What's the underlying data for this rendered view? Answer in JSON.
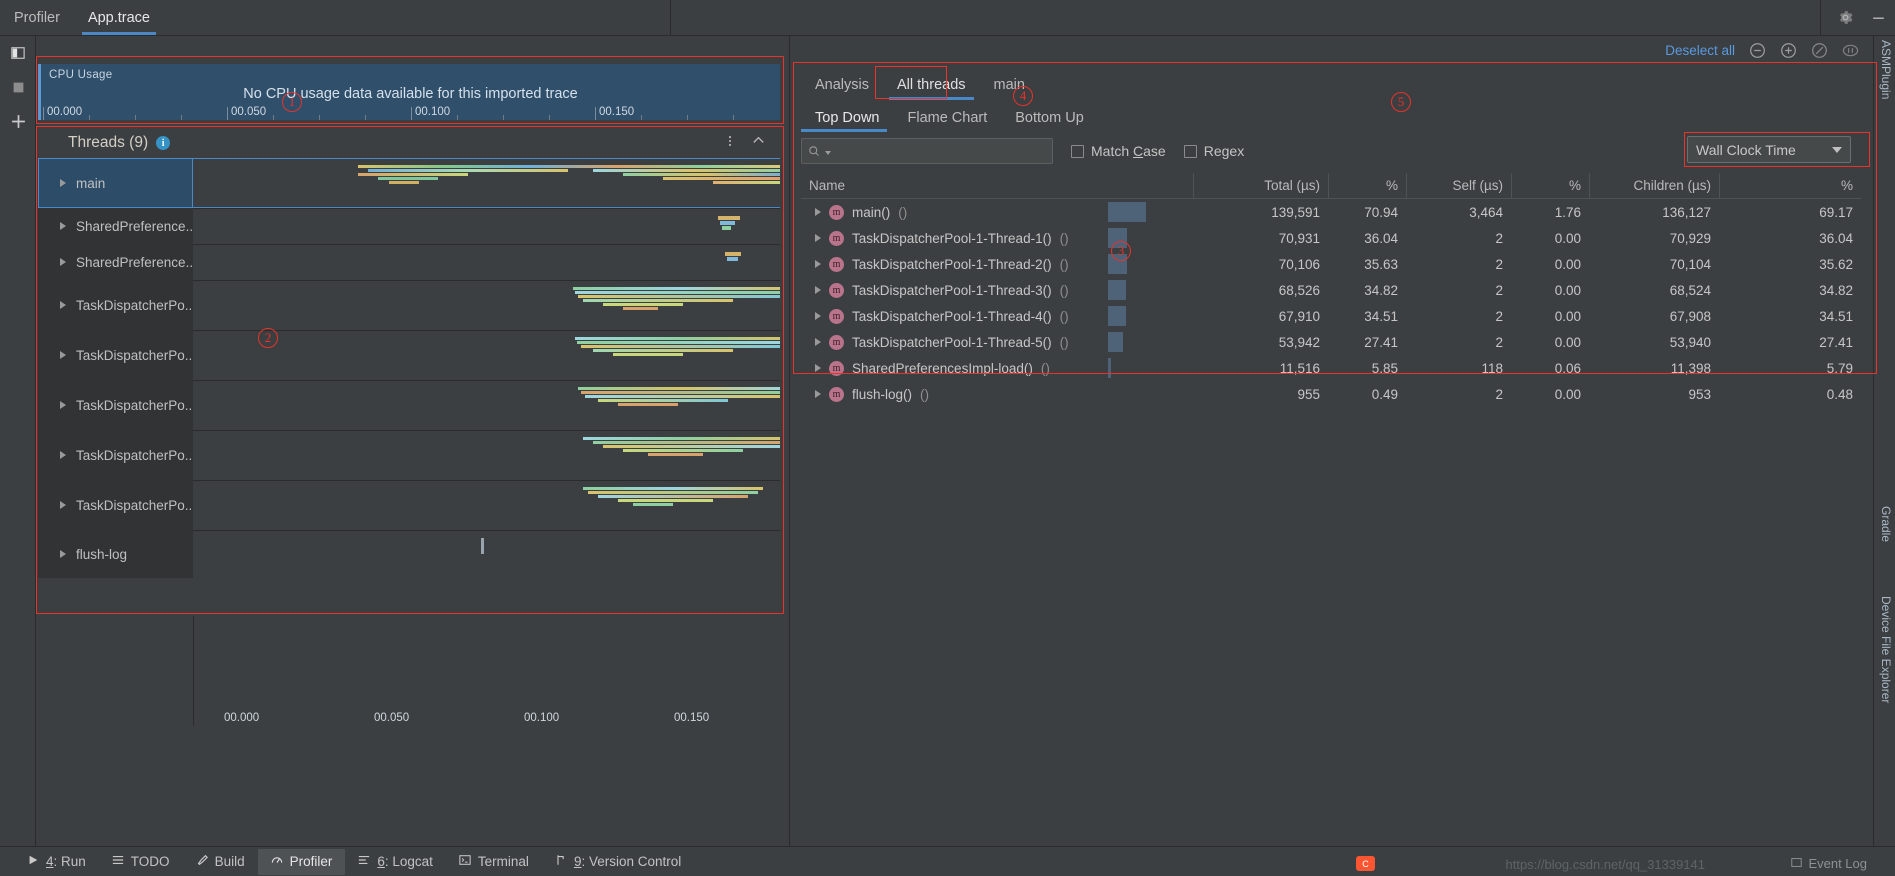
{
  "window": {
    "tabs": [
      {
        "label": "Profiler",
        "active": false
      },
      {
        "label": "App.trace",
        "active": true
      }
    ],
    "icons": [
      "gear-icon",
      "minimize-icon"
    ]
  },
  "left_rail": {
    "buttons": [
      "layout-panel-icon",
      "stop-square-icon",
      "add-plus-icon"
    ]
  },
  "right_rail": {
    "labels": [
      "ASMPlugin",
      "Gradle",
      "Device File Explorer"
    ]
  },
  "timeline": {
    "cpu": {
      "section_label": "CPU Usage",
      "empty_message": "No CPU usage data available for this imported trace",
      "axis_labels": [
        "00.000",
        "00.050",
        "00.100",
        "00.150"
      ]
    },
    "threads_panel": {
      "title": "Threads (9)",
      "info_icon": "info-icon",
      "more_icon": "more-vertical-icon",
      "collapse_icon": "chevron-up-icon"
    },
    "threads": [
      {
        "name": "main",
        "selected": true
      },
      {
        "name": "SharedPreference...",
        "selected": false
      },
      {
        "name": "SharedPreference...",
        "selected": false
      },
      {
        "name": "TaskDispatcherPo...",
        "selected": false
      },
      {
        "name": "TaskDispatcherPo...",
        "selected": false
      },
      {
        "name": "TaskDispatcherPo...",
        "selected": false
      },
      {
        "name": "TaskDispatcherPo...",
        "selected": false
      },
      {
        "name": "TaskDispatcherPo...",
        "selected": false
      },
      {
        "name": "flush-log",
        "selected": false
      }
    ],
    "bottom_axis_labels": [
      "00.000",
      "00.050",
      "00.100",
      "00.150"
    ]
  },
  "analysis": {
    "deselect_all": "Deselect all",
    "zoom_icons": [
      "zoom-out-icon",
      "zoom-in-icon",
      "zoom-reset-icon",
      "zoom-fit-icon"
    ],
    "tabs": [
      {
        "label": "Analysis",
        "active": false
      },
      {
        "label": "All threads",
        "active": true
      },
      {
        "label": "main",
        "active": false
      }
    ],
    "sub_tabs": [
      {
        "label": "Top Down",
        "active": true
      },
      {
        "label": "Flame Chart",
        "active": false
      },
      {
        "label": "Bottom Up",
        "active": false
      }
    ],
    "search": {
      "value": "",
      "placeholder": "",
      "icon": "search-icon"
    },
    "match_case": {
      "label": "Match Case",
      "underline_char": "C",
      "checked": false
    },
    "regex": {
      "label": "Regex",
      "checked": false
    },
    "clock_select": {
      "value": "Wall Clock Time"
    }
  },
  "table": {
    "columns": [
      "Name",
      "Total (µs)",
      "%",
      "Self (µs)",
      "%",
      "Children (µs)",
      "%"
    ],
    "rows": [
      {
        "name": "main()",
        "suffix": "()",
        "total": "139,591",
        "total_pct": "70.94",
        "self": "3,464",
        "self_pct": "1.76",
        "children": "136,127",
        "children_pct": "69.17",
        "bar": 100
      },
      {
        "name": "TaskDispatcherPool-1-Thread-1()",
        "suffix": "()",
        "total": "70,931",
        "total_pct": "36.04",
        "self": "2",
        "self_pct": "0.00",
        "children": "70,929",
        "children_pct": "36.04",
        "bar": 51
      },
      {
        "name": "TaskDispatcherPool-1-Thread-2()",
        "suffix": "()",
        "total": "70,106",
        "total_pct": "35.63",
        "self": "2",
        "self_pct": "0.00",
        "children": "70,104",
        "children_pct": "35.62",
        "bar": 50
      },
      {
        "name": "TaskDispatcherPool-1-Thread-3()",
        "suffix": "()",
        "total": "68,526",
        "total_pct": "34.82",
        "self": "2",
        "self_pct": "0.00",
        "children": "68,524",
        "children_pct": "34.82",
        "bar": 49
      },
      {
        "name": "TaskDispatcherPool-1-Thread-4()",
        "suffix": "()",
        "total": "67,910",
        "total_pct": "34.51",
        "self": "2",
        "self_pct": "0.00",
        "children": "67,908",
        "children_pct": "34.51",
        "bar": 49
      },
      {
        "name": "TaskDispatcherPool-1-Thread-5()",
        "suffix": "()",
        "total": "53,942",
        "total_pct": "27.41",
        "self": "2",
        "self_pct": "0.00",
        "children": "53,940",
        "children_pct": "27.41",
        "bar": 39
      },
      {
        "name": "SharedPreferencesImpl-load()",
        "suffix": "()",
        "total": "11,516",
        "total_pct": "5.85",
        "self": "118",
        "self_pct": "0.06",
        "children": "11,398",
        "children_pct": "5.79",
        "bar": 8
      },
      {
        "name": "flush-log()",
        "suffix": "()",
        "total": "955",
        "total_pct": "0.49",
        "self": "2",
        "self_pct": "0.00",
        "children": "953",
        "children_pct": "0.48",
        "bar": 1
      }
    ]
  },
  "annotations": [
    {
      "number": "1"
    },
    {
      "number": "2"
    },
    {
      "number": "3"
    },
    {
      "number": "4"
    },
    {
      "number": "5"
    }
  ],
  "statusbar": {
    "items": [
      {
        "label": "4: Run",
        "icon": "play-icon",
        "underline": "4",
        "active": false
      },
      {
        "label": "TODO",
        "icon": "list-icon",
        "underline": "",
        "active": false
      },
      {
        "label": "Build",
        "icon": "hammer-icon",
        "underline": "",
        "active": false
      },
      {
        "label": "Profiler",
        "icon": "gauge-icon",
        "underline": "",
        "active": true
      },
      {
        "label": "6: Logcat",
        "icon": "lines-icon",
        "underline": "6",
        "active": false
      },
      {
        "label": "Terminal",
        "icon": "terminal-icon",
        "underline": "",
        "active": false
      },
      {
        "label": "9: Version Control",
        "icon": "branch-icon",
        "underline": "9",
        "active": false
      }
    ],
    "event_log": "Event Log",
    "watermark": "https://blog.csdn.net/qq_31339141"
  },
  "colors": {
    "accent": "#4a88c7",
    "annotation_red": "#e8322a",
    "link_blue": "#5a9ae0",
    "cpu_panel": "#2f4f6b",
    "bar_fill": "#4e6378"
  }
}
